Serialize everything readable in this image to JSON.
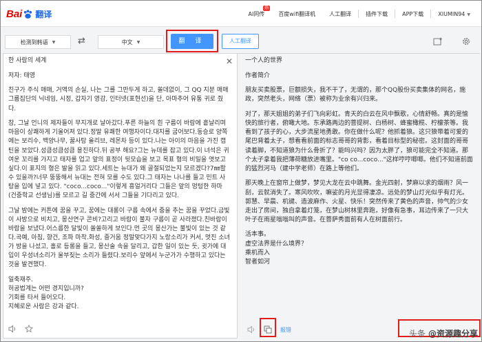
{
  "logo": {
    "bai": "Bai",
    "fanyi": "翻译"
  },
  "nav": {
    "items": [
      "AI同传",
      "百度wifi翻译机",
      "人工翻译",
      "插件下载",
      "APP下载",
      "XIUMIN94"
    ],
    "badge": "热"
  },
  "toolbar": {
    "source_lang": "检测到韩语",
    "target_lang": "中文",
    "translate_label": "翻 译",
    "human_label": "人工翻译"
  },
  "source": {
    "paragraphs": [
      "한 사람의 세계",
      "저자: 태영",
      "친구가 주식 매매, 거액의 손실, 나는 그를 그만두게 하고, 쏠데없이, 그 QQ 지분 매매그룹집단의 닉네임, 시정, 갑자기 영감, 인터넷(표현선)을 단, 아마추어 유통 귀로 줬다.",
      "참, 그날 언니의 제자들이 무지개로 날아갔다.푸른 하늘의 흰 구름이 바람에 흩날리며 마음이 상쾌하게 기울어져 있다.정말 유쾌한 여행자이다.대지를 굽어보다.동승로 양쪽에는 보리수, 백양나무, 꿀사탕 올리브, 레몬차 등이 있다.나는 아이의 마음을 가진 캡틴을 보았다.성큼성큼성큼 용진하다.뒤 공부 해요?그는 뉴데를 잡고 있다.이 녀석은 귀여운 꼬리를 가지고 태자를 업고 앞의 표정이 뒷모습을 보고 목표 형의 비밀을 엿보고 싶다.이 표지의 형은 발을 읽고 있다.세트는 뉴대가 왜 골절되었는지 모르겠다?7㎜할 수 있을까?너무 뚱뚱해서 뉴대는 전혀 모를 수도 있다.그 태자는 나나를 들고 민트 사탕을 입에 넣고 있다. \"coco...coco...\"이렇게 흥얼거리다 그들은 앞의 멍텅한 하마 (건중학교 선생님)를 모르고 길 중간에 서서 그들을 기다리고 있다.",
      "그날 밤에는 커튼에 꿈을 꾸고, 꿈에는 대롱이 구름 속에서 중을 추는 꿈을 꾸었다.금빛이 사방으로 비치고, 몽산연구 콘비?고리고 바람이 불자 구름이 곧 사라졌다.친바람이 바람을 보냈다.어스름한 달빛이 쏠쏠하게 보인다.먼 곳의 몽산가는 불빛이 있는 것 같다.곡예, 아침, 향건, 조파 마착.화성, 즐거움 정말맞다가지 노랑소리가 커서, 멋진 소녀가 방을 나섰고, 홀로 등롱을 들고, 몽산술 속을 달리고, 갑한 일이 있는 듯, 귓가에 대입이 우성녀소리가 울부짖는 소리가 들렸다.보리수 앞에서 누군가가 수행하고 있다는 것을 발견했다.",
      "일축재주.\n허공법계는 어떤 경지입니까?\n기회를 타서 들어오다.\n지혜로운 사람은 강과 같다."
    ]
  },
  "target": {
    "paragraphs": [
      "一个人的世界",
      "作者简介",
      "朋友买卖股票，巨额损失，我不干了，无谓的，那个QQ股份买卖集体的网名，施政，突然老头，网络（票）被称为业余有兴归来。",
      "对了，那天姐姐的弟子们飞向彩虹。青天的白云在风中飘歌，心情舒畅。真的是愉快的旅行者，俯瞰大地。东承路两边的菩提树、白杨树、蜂蜜橄榄、柠檬茶等。我看到了孩子的心，大步流星地勇敢。你在做什么呢？他抓着狼。这只狼带着可爱的尾巴背着太子，想看看前面的标志哥哥的背影，看着目标型的秘密。这封面的哥哥读着脚，不知道狼为什么骨折了？能吗兴吗？因为太胖了，狼可能完全不知道。那个太子拿着我把薄荷糖放进嘴里。\"co co...coco...\"这样哼哼唧唧。他们不知道前面的猛烈河马（建中学老师）在路上等他们。",
      "那天晚上在窗帘上做梦，梦见大龙在云中跳舞。金光四射，梦麻以求的烟雨？风一刮，云就消失了。寒风吹吹，嘛娑的月光显得凄凉。远处的梦山灯光似乎有灯光。郭慧、早晨、机键、造波麻作、火星、快乐！突然传来了黄色的声音，帅气的少女走出了房间，独自拿着灯笼，在梦山树林里奔跑，好像有急事，耳边传来了一只大叶子在雨星嗡嗡叫的声音。在菩萨秀面前有人在树面前行。",
      "活本事。\n虚空法界是什么境界？\n乘机而入\n智者如河"
    ]
  },
  "footer": {
    "report_label": "报错",
    "watermark_prefix": "头条",
    "watermark_main": "@资源趣分享"
  },
  "colors": {
    "accent": "#4395ff",
    "highlight": "#e21b1b",
    "logo_red": "#e10602"
  }
}
